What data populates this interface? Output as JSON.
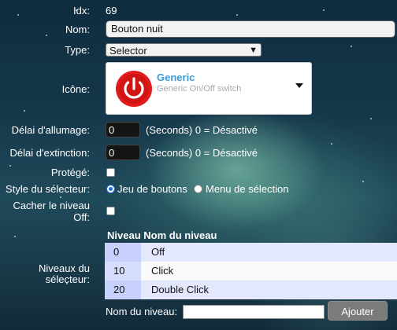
{
  "idx": {
    "label": "Idx:",
    "value": "69"
  },
  "name": {
    "label": "Nom:",
    "value": "Bouton nuit"
  },
  "type": {
    "label": "Type:",
    "value": "Selector"
  },
  "icon": {
    "label": "Icône:",
    "title": "Generic",
    "subtitle": "Generic On/Off switch",
    "glyph": "power-icon",
    "color": "#e21b1b"
  },
  "on_delay": {
    "label": "Délai d'allumage:",
    "value": "0",
    "hint": "(Seconds) 0 = Désactivé"
  },
  "off_delay": {
    "label": "Délai d'extinction:",
    "value": "0",
    "hint": "(Seconds) 0 = Désactivé"
  },
  "protected": {
    "label": "Protégé:",
    "checked": false
  },
  "selector_style": {
    "label": "Style du sélecteur:",
    "options": [
      {
        "label": "Jeu de boutons",
        "selected": true
      },
      {
        "label": "Menu de sélection",
        "selected": false
      }
    ]
  },
  "hide_off": {
    "label_line1": "Cacher le niveau",
    "label_line2": "Off:",
    "checked": false
  },
  "levels": {
    "label_line1": "Niveaux du",
    "label_line2": "sélecteur:",
    "columns": [
      "Niveau",
      "Nom du niveau"
    ],
    "rows": [
      {
        "level": "0",
        "name": "Off"
      },
      {
        "level": "10",
        "name": "Click"
      },
      {
        "level": "20",
        "name": "Double Click"
      }
    ],
    "new_level_label": "Nom du niveau:",
    "new_level_value": "",
    "add_button": "Ajouter"
  }
}
